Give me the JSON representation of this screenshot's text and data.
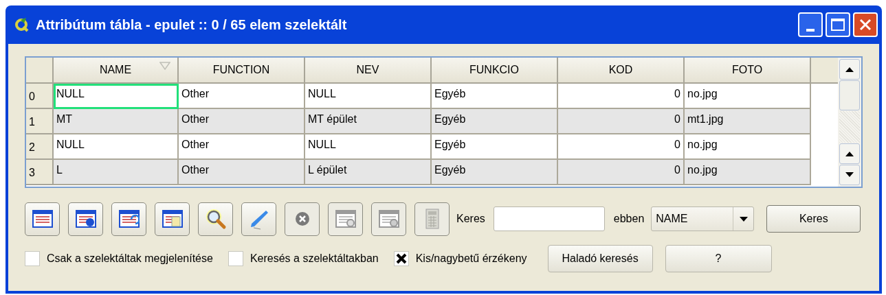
{
  "window": {
    "title": "Attribútum tábla - epulet :: 0 / 65 elem szelektált"
  },
  "table": {
    "columns": [
      {
        "label": "NAME",
        "sorted": true,
        "kind": "text"
      },
      {
        "label": "FUNCTION",
        "sorted": false,
        "kind": "text"
      },
      {
        "label": "NEV",
        "sorted": false,
        "kind": "text"
      },
      {
        "label": "FUNKCIO",
        "sorted": false,
        "kind": "text"
      },
      {
        "label": "KOD",
        "sorted": false,
        "kind": "number"
      },
      {
        "label": "FOTO",
        "sorted": false,
        "kind": "text"
      }
    ],
    "rows": [
      {
        "index": "0",
        "cells": [
          {
            "text": "NULL",
            "focused": true
          },
          {
            "text": "Other",
            "focused": false
          },
          {
            "text": "NULL",
            "focused": false
          },
          {
            "text": "Egyéb",
            "focused": false
          },
          {
            "text": "0",
            "focused": false
          },
          {
            "text": "no.jpg",
            "focused": false
          }
        ]
      },
      {
        "index": "1",
        "cells": [
          {
            "text": "MT",
            "focused": false
          },
          {
            "text": "Other",
            "focused": false
          },
          {
            "text": "MT épület",
            "focused": false
          },
          {
            "text": "Egyéb",
            "focused": false
          },
          {
            "text": "0",
            "focused": false
          },
          {
            "text": "mt1.jpg",
            "focused": false
          }
        ]
      },
      {
        "index": "2",
        "cells": [
          {
            "text": "NULL",
            "focused": false
          },
          {
            "text": "Other",
            "focused": false
          },
          {
            "text": "NULL",
            "focused": false
          },
          {
            "text": "Egyéb",
            "focused": false
          },
          {
            "text": "0",
            "focused": false
          },
          {
            "text": "no.jpg",
            "focused": false
          }
        ]
      },
      {
        "index": "3",
        "cells": [
          {
            "text": "L",
            "focused": false
          },
          {
            "text": "Other",
            "focused": false
          },
          {
            "text": "L épület",
            "focused": false
          },
          {
            "text": "Egyéb",
            "focused": false
          },
          {
            "text": "0",
            "focused": false
          },
          {
            "text": "no.jpg",
            "focused": false
          }
        ]
      }
    ]
  },
  "toolbar": [
    {
      "kind": "table",
      "disabled": false
    },
    {
      "kind": "table-plus",
      "disabled": false
    },
    {
      "kind": "table-swap",
      "disabled": false
    },
    {
      "kind": "table-copy",
      "disabled": false
    },
    {
      "kind": "zoom",
      "disabled": false
    },
    {
      "kind": "pen",
      "disabled": false
    },
    {
      "kind": "clear",
      "disabled": true
    },
    {
      "kind": "table-gear",
      "disabled": true
    },
    {
      "kind": "table-x",
      "disabled": true
    },
    {
      "kind": "calculator",
      "disabled": true
    }
  ],
  "search": {
    "label": "Keres",
    "in_label": "ebben",
    "field_value": "NAME",
    "button": "Keres"
  },
  "options": [
    {
      "label": "Csak a szelektáltak megjelenítése",
      "checked": false
    },
    {
      "label": "Keresés a szelektáltakban",
      "checked": false
    },
    {
      "label": "Kis/nagybetű érzékeny",
      "checked": true
    }
  ],
  "buttons": [
    "Haladó keresés",
    "?"
  ]
}
